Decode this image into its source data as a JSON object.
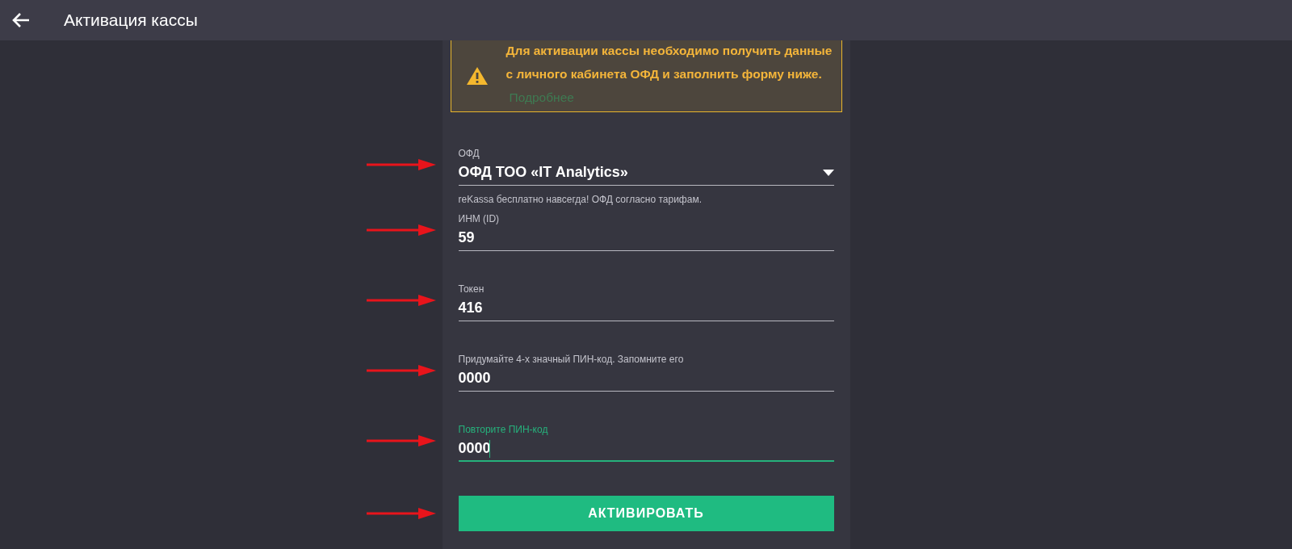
{
  "header": {
    "title": "Активация кассы"
  },
  "alert": {
    "text": "Для активации кассы необходимо получить данные с личного кабинета ОФД и заполнить форму ниже.",
    "link": "Подробнее"
  },
  "fields": [
    {
      "kind": "select",
      "label": "ОФД",
      "value": "ОФД ТОО «IT Analytics»",
      "helper": "reKassa бесплатно навсегда! ОФД согласно тарифам.",
      "focused": false
    },
    {
      "kind": "input",
      "label": "ИНМ (ID)",
      "value": "59",
      "focused": false
    },
    {
      "kind": "input",
      "label": "Токен",
      "value": "416",
      "focused": false
    },
    {
      "kind": "input",
      "label": "Придумайте 4-х значный ПИН-код. Запомните его",
      "value": "0000",
      "focused": false
    },
    {
      "kind": "input",
      "label": "Повторите ПИН-код",
      "value": "0000",
      "focused": true
    }
  ],
  "activate_button": {
    "label": "АКТИВИРОВАТЬ"
  }
}
